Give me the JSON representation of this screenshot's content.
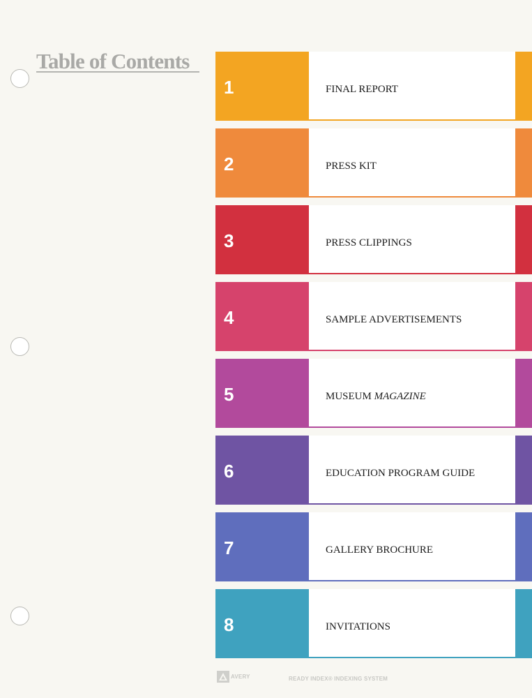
{
  "title": "Table of Contents",
  "sections": [
    {
      "number": "1",
      "label": "FINAL REPORT",
      "color": "#f3a522"
    },
    {
      "number": "2",
      "label": "PRESS KIT",
      "color": "#ef8a3c"
    },
    {
      "number": "3",
      "label": "PRESS CLIPPINGS",
      "color": "#d2303f"
    },
    {
      "number": "4",
      "label": "SAMPLE ADVERTISEMENTS",
      "color": "#d6436c"
    },
    {
      "number": "5",
      "label": "MUSEUM",
      "label_italic": "MAGAZINE",
      "color": "#b24a9c"
    },
    {
      "number": "6",
      "label": "EDUCATION PROGRAM GUIDE",
      "color": "#6f54a3"
    },
    {
      "number": "7",
      "label": "GALLERY BROCHURE",
      "color": "#5f6ebd"
    },
    {
      "number": "8",
      "label": "INVITATIONS",
      "color": "#3fa2bf"
    }
  ],
  "footer": {
    "brand": "AVERY",
    "system": "READY INDEX® INDEXING SYSTEM"
  }
}
